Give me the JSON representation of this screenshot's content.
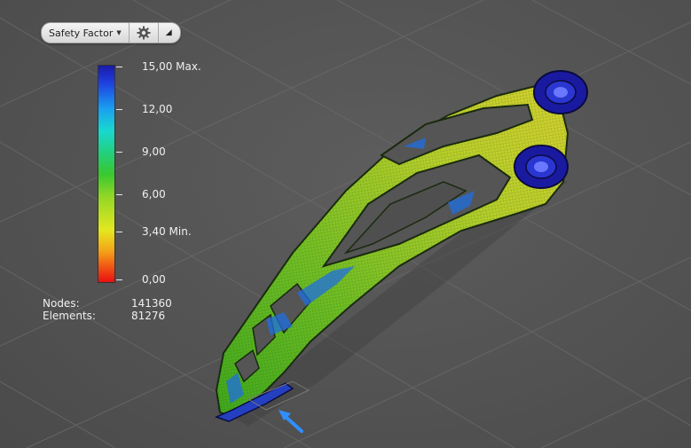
{
  "toolbar": {
    "result_type": "Safety Factor",
    "settings_icon": "gear-icon",
    "collapse_icon": "triangle-up-icon"
  },
  "legend": {
    "max_label": "15,00 Max.",
    "tick_12": "12,00",
    "tick_9": "9,00",
    "tick_6": "6,00",
    "min_label": "3,40 Min.",
    "zero_label": "0,00"
  },
  "stats": {
    "nodes_label": "Nodes:",
    "nodes_value": "141360",
    "elements_label": "Elements:",
    "elements_value": "81276"
  },
  "colors": {
    "background": "#545454",
    "grid": "#6a6a6a",
    "colorbar_top": "#1a1aa8",
    "colorbar_bottom": "#e81010",
    "load_arrow": "#2f8fff"
  }
}
